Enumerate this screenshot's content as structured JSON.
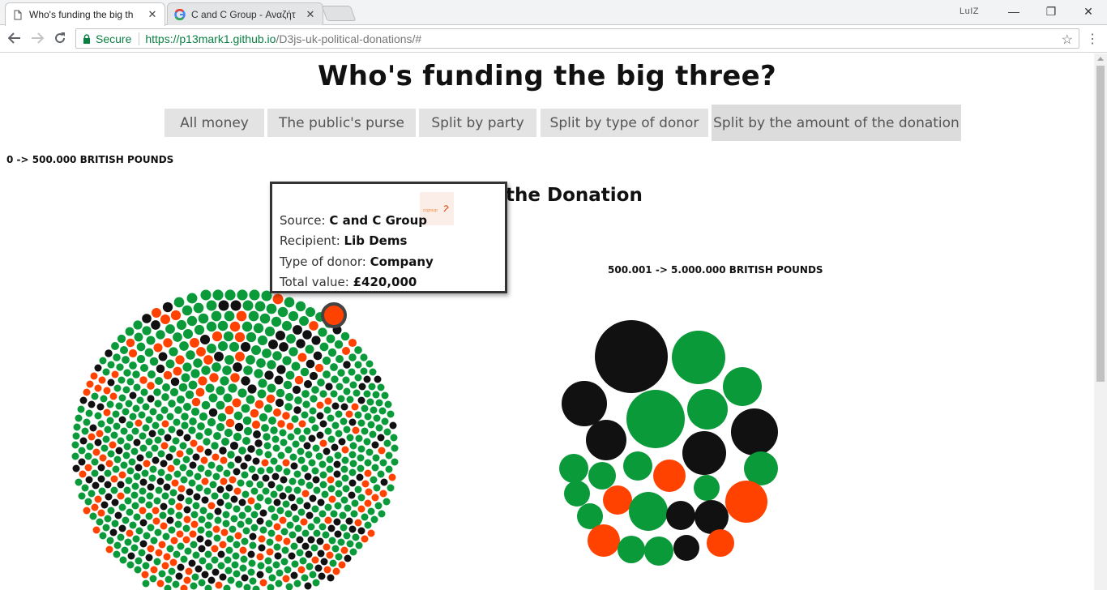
{
  "browser": {
    "tabs": [
      {
        "title": "Who's funding the big th",
        "active": true
      },
      {
        "title": "C and C Group - Αναζήτ",
        "active": false
      }
    ],
    "profile": "LuIZ",
    "secure_label": "Secure",
    "url_host": "https://p13mark1.github.io",
    "url_path": "/D3js-uk-political-donations/#"
  },
  "page": {
    "title": "Who's funding the big three?",
    "buttons": [
      "All money",
      "The public's purse",
      "Split by party",
      "Split by type of donor",
      "Split by the amount of the donation"
    ],
    "active_button": "Split by the amount of the donation",
    "section_title": "the Donation",
    "scale_labels": [
      "0 -> 500.000 BRITISH POUNDS",
      "500.001 -> 5.000.000 BRITISH POUNDS"
    ]
  },
  "tooltip": {
    "source_label": "Source: ",
    "source": "C and C Group",
    "recipient_label": "Recipient: ",
    "recipient": "Lib Dems",
    "type_label": "Type of donor: ",
    "type": "Company",
    "value_label": "Total value: ",
    "value": "£420,000",
    "logo_name": "c-and-c-group-logo"
  },
  "colors": {
    "party_a": "#0a9a3a",
    "party_b": "#111111",
    "party_c": "#ff4200",
    "secure": "#0b8043"
  }
}
